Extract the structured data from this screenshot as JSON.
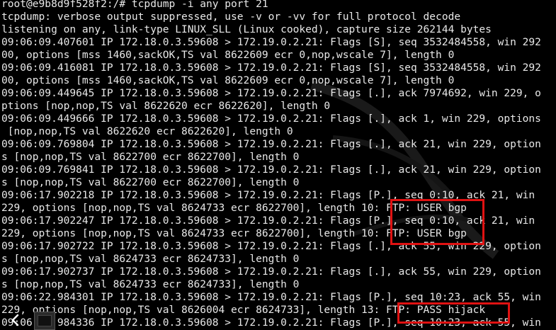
{
  "terminal": {
    "lines": [
      "root@e9b8d9f528f2:/# tcpdump -i any port 21",
      "tcpdump: verbose output suppressed, use -v or -vv for full protocol decode",
      "listening on any, link-type LINUX_SLL (Linux cooked), capture size 262144 bytes",
      "09:06:09.407601 IP 172.18.0.3.59608 > 172.19.0.2.21: Flags [S], seq 3532484558, win 292",
      "00, options [mss 1460,sackOK,TS val 8622609 ecr 0,nop,wscale 7], length 0",
      "09:06:09.416081 IP 172.18.0.3.59608 > 172.19.0.2.21: Flags [S], seq 3532484558, win 292",
      "00, options [mss 1460,sackOK,TS val 8622609 ecr 0,nop,wscale 7], length 0",
      "09:06:09.449645 IP 172.18.0.3.59608 > 172.19.0.2.21: Flags [.], ack 7974692, win 229, o",
      "ptions [nop,nop,TS val 8622620 ecr 8622620], length 0",
      "09:06:09.449666 IP 172.18.0.3.59608 > 172.19.0.2.21: Flags [.], ack 1, win 229, options",
      " [nop,nop,TS val 8622620 ecr 8622620], length 0",
      "09:06:09.769804 IP 172.18.0.3.59608 > 172.19.0.2.21: Flags [.], ack 21, win 229, option",
      "s [nop,nop,TS val 8622700 ecr 8622700], length 0",
      "09:06:09.769841 IP 172.18.0.3.59608 > 172.19.0.2.21: Flags [.], ack 21, win 229, option",
      "s [nop,nop,TS val 8622700 ecr 8622700], length 0",
      "09:06:17.902218 IP 172.18.0.3.59608 > 172.19.0.2.21: Flags [P.], seq 0:10, ack 21, win",
      "229, options [nop,nop,TS val 8624733 ecr 8622700], length 10: FTP: USER bgp",
      "09:06:17.902247 IP 172.18.0.3.59608 > 172.19.0.2.21: Flags [P.], seq 0:10, ack 21, win",
      "229, options [nop,nop,TS val 8624733 ecr 8622700], length 10: FTP: USER bgp",
      "09:06:17.902722 IP 172.18.0.3.59608 > 172.19.0.2.21: Flags [.], ack 55, win 229, option",
      "s [nop,nop,TS val 8624733 ecr 8624733], length 0",
      "09:06:17.902737 IP 172.18.0.3.59608 > 172.19.0.2.21: Flags [.], ack 55, win 229, option",
      "s [nop,nop,TS val 8624733 ecr 8624733], length 0",
      "09:06:22.984301 IP 172.18.0.3.59608 > 172.19.0.2.21: Flags [P.], seq 10:23, ack 55, win",
      "229, options [nop,nop,TS val 8626004 ecr 8624733], length 13: FTP: PASS hijack",
      "09:06:22.984336 IP 172.18.0.3.59608 > 172.19.0.2.21: Flags [P.], seq 10:23, ack 55, win"
    ]
  },
  "colors": {
    "background": "#000000",
    "text": "#e8e8e8",
    "highlight_border": "#e01212",
    "taskbar_icon": "#ffffff"
  },
  "icons": {
    "back": "chevron-left-icon",
    "window": "window-icon"
  }
}
